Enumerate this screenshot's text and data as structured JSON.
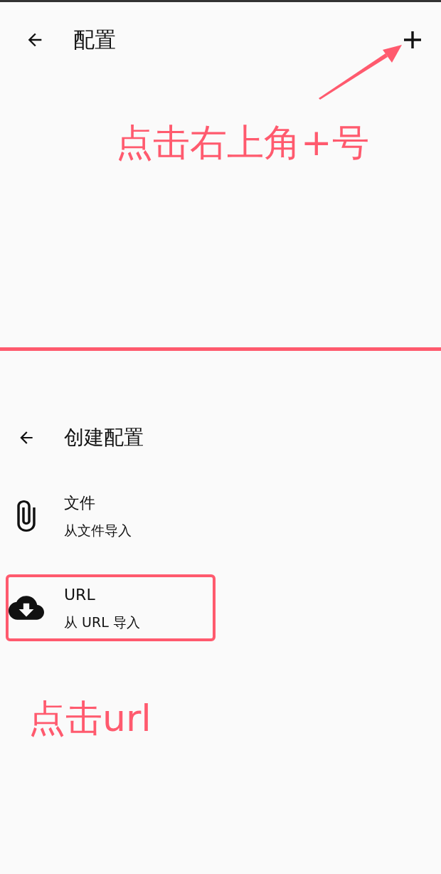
{
  "top_screen": {
    "title": "配置",
    "annotation": "点击右上角+号"
  },
  "bottom_screen": {
    "title": "创建配置",
    "items": [
      {
        "kind": "file",
        "title": "文件",
        "subtitle": "从文件导入",
        "highlighted": false
      },
      {
        "kind": "url",
        "title": "URL",
        "subtitle": "从 URL 导入",
        "highlighted": true
      }
    ],
    "annotation": "点击url"
  }
}
